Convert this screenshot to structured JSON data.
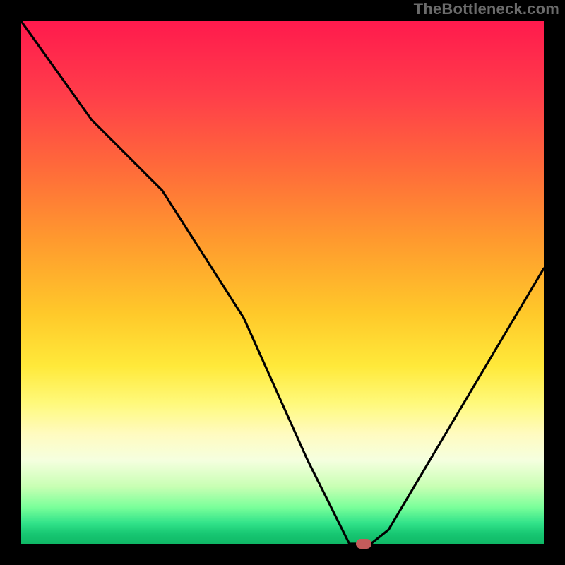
{
  "watermark": "TheBottleneck.com",
  "colors": {
    "frame_bg": "#000000",
    "gradient_top": "#ff1a4d",
    "gradient_bottom": "#0fb866",
    "curve_stroke": "#000000",
    "marker_fill": "#c45b5b",
    "watermark_text": "#6b6b6b"
  },
  "chart_data": {
    "type": "line",
    "title": "",
    "xlabel": "",
    "ylabel": "",
    "xlim": [
      0,
      100
    ],
    "ylim": [
      0,
      100
    ],
    "grid": false,
    "legend": false,
    "background_gradient": "top=bottleneck-high(red), bottom=bottleneck-low(green)",
    "series": [
      {
        "name": "bottleneck-curve",
        "x": [
          0.0,
          13.5,
          27.0,
          42.6,
          54.7,
          62.8,
          66.9,
          70.3,
          100.0
        ],
        "y": [
          100.0,
          81.1,
          67.6,
          43.2,
          16.2,
          0.0,
          0.0,
          2.7,
          52.7
        ]
      }
    ],
    "annotations": [
      {
        "name": "optimal-marker",
        "x": 65.5,
        "y": 0.0,
        "shape": "rounded-rect",
        "color": "#c45b5b"
      }
    ]
  }
}
